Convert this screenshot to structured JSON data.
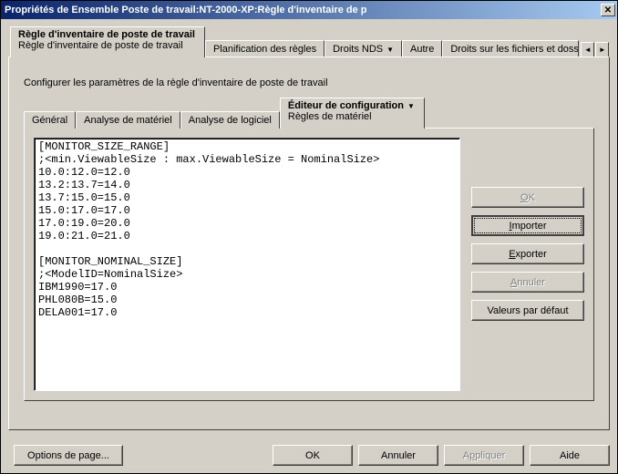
{
  "window": {
    "title": "Propriétés de Ensemble Poste de travail:NT-2000-XP:Règle d'inventaire de p"
  },
  "tabs": {
    "active_title": "Règle d'inventaire de poste de travail",
    "active_subtitle": "Règle d'inventaire de poste de travail",
    "items": [
      "Planification des règles",
      "Droits NDS",
      "Autre",
      "Droits sur les fichiers et doss"
    ]
  },
  "panel": {
    "description": "Configurer les paramètres de la règle d'inventaire de poste de travail"
  },
  "subtabs": {
    "items": [
      "Général",
      "Analyse de matériel",
      "Analyse de logiciel"
    ],
    "active_title": "Éditeur de configuration",
    "active_subtitle": "Règles de matériel"
  },
  "editor": {
    "content": "[MONITOR_SIZE_RANGE]\n;<min.ViewableSize : max.ViewableSize = NominalSize>\n10.0:12.0=12.0\n13.2:13.7=14.0\n13.7:15.0=15.0\n15.0:17.0=17.0\n17.0:19.0=20.0\n19.0:21.0=21.0\n\n[MONITOR_NOMINAL_SIZE]\n;<ModelID=NominalSize>\nIBM1990=17.0\nPHL080B=15.0\nDELA001=17.0\n"
  },
  "side_buttons": {
    "ok": "OK",
    "import": "Importer",
    "export": "Exporter",
    "cancel": "Annuler",
    "defaults": "Valeurs par défaut"
  },
  "bottom_buttons": {
    "page_options": "Options de page...",
    "ok": "OK",
    "cancel": "Annuler",
    "apply": "Appliquer",
    "help": "Aide"
  }
}
